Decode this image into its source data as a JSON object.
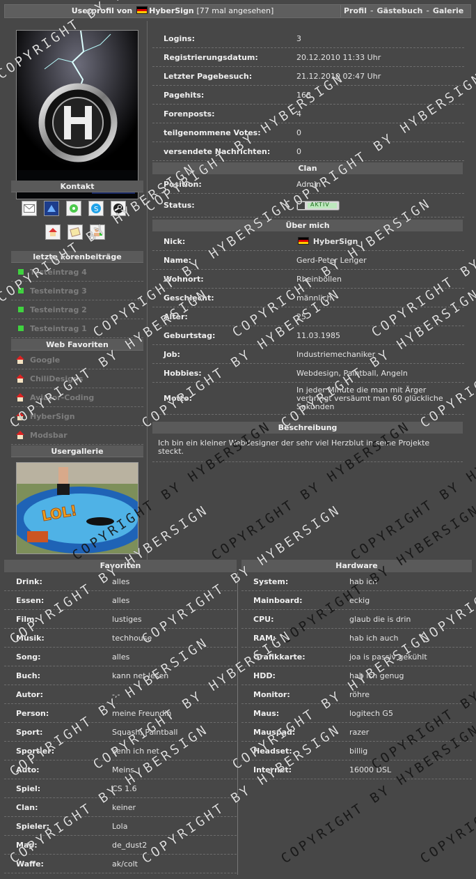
{
  "header": {
    "title_prefix": "Userprofil von",
    "username": "HyberSign",
    "views": "[77 mal angesehen]",
    "nav": [
      "Profil",
      "Gästebuch",
      "Galerie"
    ],
    "nav_sep": "-"
  },
  "left": {
    "kontakt": "Kontakt",
    "forum_title": "letzte Forenbeiträge",
    "forum_posts": [
      "Testeintrag 4",
      "Testeintrag 3",
      "Testeintrag 2",
      "Testeintrag 1"
    ],
    "fav_title": "Web Favoriten",
    "favorites": [
      "Google",
      "ChiliDesigns",
      "Aviator-Coding",
      "HyberSign",
      "Modsbar"
    ],
    "gallery_title": "Usergallerie",
    "gallery_caption": "LOL!"
  },
  "stats": [
    {
      "k": "Logins:",
      "v": "3"
    },
    {
      "k": "Registrierungsdatum:",
      "v": "20.12.2010 11:33 Uhr"
    },
    {
      "k": "Letzter Pagebesuch:",
      "v": "21.12.2010 02:47 Uhr"
    },
    {
      "k": "Pagehits:",
      "v": "168"
    },
    {
      "k": "Forenposts:",
      "v": "4"
    },
    {
      "k": "teilgenommene Votes:",
      "v": "0"
    },
    {
      "k": "versendete Nachrichten:",
      "v": "0"
    }
  ],
  "clan": {
    "title": "Clan",
    "position_k": "Position:",
    "position_v": "Admin",
    "status_k": "Status:",
    "status_v": "AKTIV"
  },
  "about": {
    "title": "Über mich",
    "rows": [
      {
        "k": "Nick:",
        "v": "HyberSign"
      },
      {
        "k": "Name:",
        "v": "Gerd-Peter Lenger"
      },
      {
        "k": "Wohnort:",
        "v": "Rheinböllen"
      },
      {
        "k": "Geschlecht:",
        "v": "männlich"
      },
      {
        "k": "Alter:",
        "v": "25"
      },
      {
        "k": "Geburtstag:",
        "v": "11.03.1985"
      },
      {
        "k": "Job:",
        "v": "Industriemechaniker"
      },
      {
        "k": "Hobbies:",
        "v": "Webdesign, Paintball, Angeln"
      }
    ],
    "motto_k": "Motto:",
    "motto_lines": [
      "In jeder Minute die man mit Ärger",
      "verbringt versäumt man 60 glückliche",
      "Sekunden"
    ]
  },
  "beschreibung": {
    "title": "Beschreibung",
    "text": "Ich bin ein kleiner Webdesigner der sehr viel Herzblut in seine Projekte steckt."
  },
  "favoriten": {
    "title": "Favoriten",
    "rows": [
      {
        "k": "Drink:",
        "v": "alles"
      },
      {
        "k": "Essen:",
        "v": "alles"
      },
      {
        "k": "Film:",
        "v": "lustiges"
      },
      {
        "k": "Musik:",
        "v": "techhouse"
      },
      {
        "k": "Song:",
        "v": "alles"
      },
      {
        "k": "Buch:",
        "v": "kann net lesen"
      },
      {
        "k": "Autor:",
        "v": "-,-"
      },
      {
        "k": "Person:",
        "v": "meine Freundin"
      },
      {
        "k": "Sport:",
        "v": "Squash, Paintball"
      },
      {
        "k": "Sportler:",
        "v": "kenn ich net"
      },
      {
        "k": "Auto:",
        "v": "Meins"
      },
      {
        "k": "Spiel:",
        "v": "CS 1.6"
      },
      {
        "k": "Clan:",
        "v": "keiner"
      },
      {
        "k": "Spieler:",
        "v": "Lola"
      },
      {
        "k": "Map:",
        "v": "de_dust2"
      },
      {
        "k": "Waffe:",
        "v": "ak/colt"
      }
    ]
  },
  "hardware": {
    "title": "Hardware",
    "rows": [
      {
        "k": "System:",
        "v": "hab ich"
      },
      {
        "k": "Mainboard:",
        "v": "eckig"
      },
      {
        "k": "CPU:",
        "v": "glaub die is drin"
      },
      {
        "k": "RAM:",
        "v": "hab ich auch"
      },
      {
        "k": "Grafikkarte:",
        "v": "joa is passiv gekühlt"
      },
      {
        "k": "HDD:",
        "v": "hab ich genug"
      },
      {
        "k": "Monitor:",
        "v": "röhre"
      },
      {
        "k": "Maus:",
        "v": "logitech G5"
      },
      {
        "k": "Mauspad:",
        "v": "razer"
      },
      {
        "k": "Headset:",
        "v": "billig"
      },
      {
        "k": "Internet:",
        "v": "16000 DSL"
      }
    ]
  },
  "watermark": "COPYRIGHT BY HYBERSIGN",
  "colors": {
    "bg": "#474747",
    "bar": "#5a5a5a",
    "bullet": "#3fd23f",
    "badge": "#2e9a2e"
  }
}
